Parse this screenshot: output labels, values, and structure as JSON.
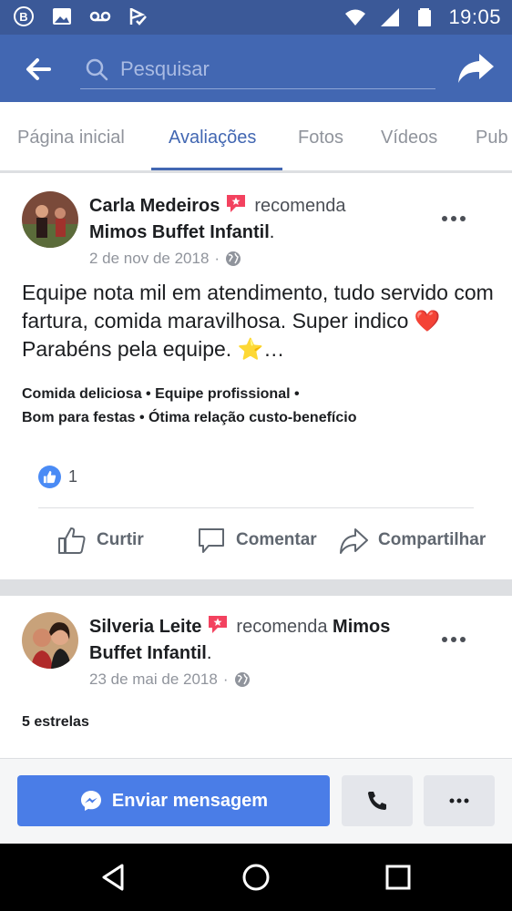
{
  "status_bar": {
    "time": "19:05",
    "left_icons": [
      "b-badge-icon",
      "image-icon",
      "voicemail-icon",
      "check-flag-icon"
    ],
    "right_icons": [
      "wifi-icon",
      "signal-icon",
      "battery-icon"
    ]
  },
  "header": {
    "search_placeholder": "Pesquisar"
  },
  "tabs": [
    {
      "label": "Página inicial",
      "active": false
    },
    {
      "label": "Avaliações",
      "active": true
    },
    {
      "label": "Fotos",
      "active": false
    },
    {
      "label": "Vídeos",
      "active": false
    },
    {
      "label": "Pub",
      "active": false
    }
  ],
  "reviews": [
    {
      "author": "Carla Medeiros",
      "verb": "recomenda",
      "page": "Mimos Buffet Infantil",
      "date": "2 de nov de 2018",
      "text": "Equipe nota mil em atendimento, tudo servido com fartura, comida maravilhosa. Super indico ❤️ Parabéns pela equipe. ⭐…",
      "tags_line1": "Comida deliciosa  •  Equipe profissional  •",
      "tags_line2": "Bom para festas  •  Ótima relação custo-benefício",
      "like_count": "1",
      "actions": {
        "like": "Curtir",
        "comment": "Comentar",
        "share": "Compartilhar"
      }
    },
    {
      "author": "Silveria Leite",
      "verb": "recomenda",
      "page_part1": "Mimos",
      "page_part2": "Buffet Infantil",
      "date": "23 de mai de 2018",
      "rating_text": "5 estrelas"
    }
  ],
  "bottom_bar": {
    "message_button": "Enviar mensagem"
  },
  "colors": {
    "brand": "#4267b2",
    "status_bar": "#3b5998",
    "button_blue": "#4a7de7",
    "recommend_badge": "#f3425f"
  }
}
